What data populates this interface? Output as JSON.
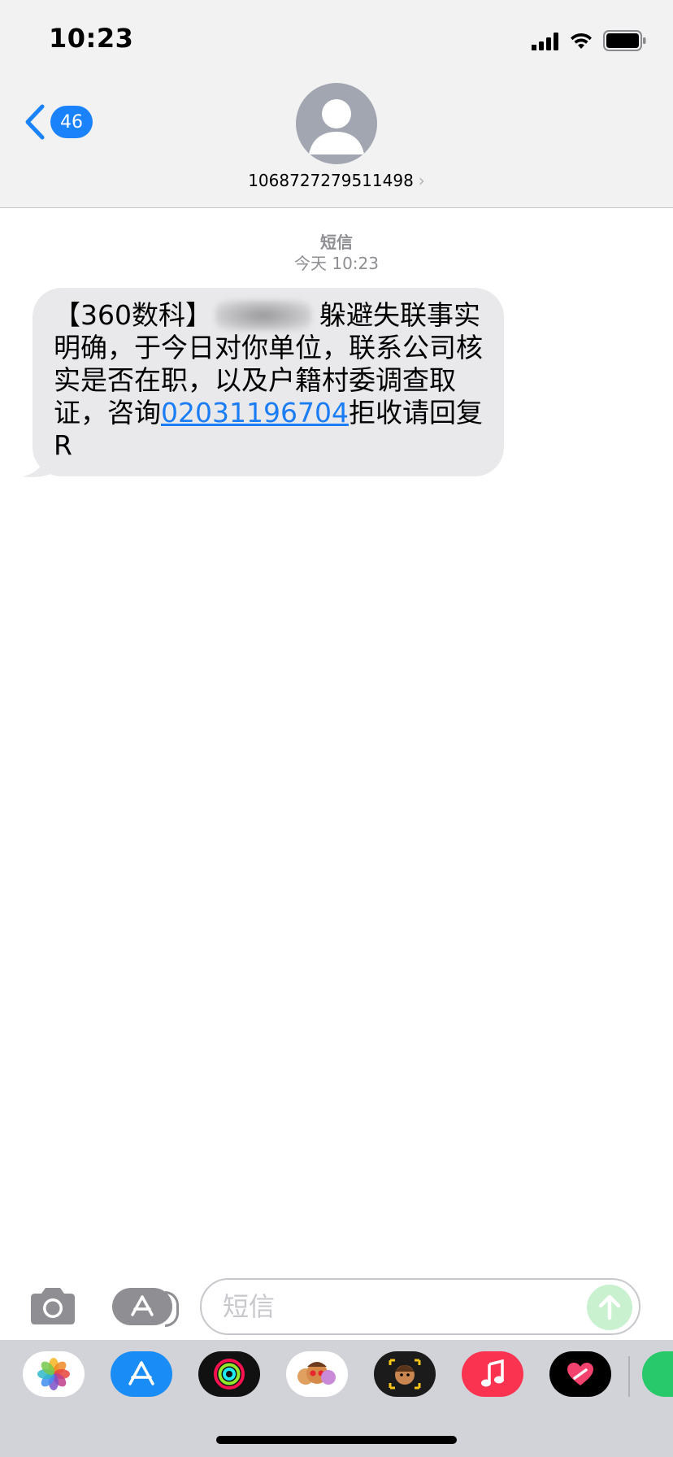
{
  "status_bar": {
    "time": "10:23"
  },
  "header": {
    "back_badge": "46",
    "contact_number": "1068727279511498",
    "chevron": "›"
  },
  "conversation": {
    "service_label": "短信",
    "timestamp": "今天 10:23",
    "message": {
      "part1": "【360数科】",
      "part2": "躲避失联事实明确，于今日对你单位，联系公司核实是否在职，以及户籍村委调查取证，咨询",
      "link": "02031196704",
      "part3": "拒收请回复R"
    }
  },
  "input": {
    "placeholder": "短信"
  },
  "app_drawer": {
    "apps": [
      "photos-app",
      "app-store-app",
      "activity-app",
      "memoji-stickers-app",
      "animoji-app",
      "music-app",
      "digital-touch-app",
      "partial-app"
    ]
  },
  "colors": {
    "accent": "#1a82fb",
    "link": "#1a7df5",
    "bubble": "#e9e9eb",
    "header_bg": "#f2f2f2",
    "drawer_bg": "#d1d3d9"
  }
}
